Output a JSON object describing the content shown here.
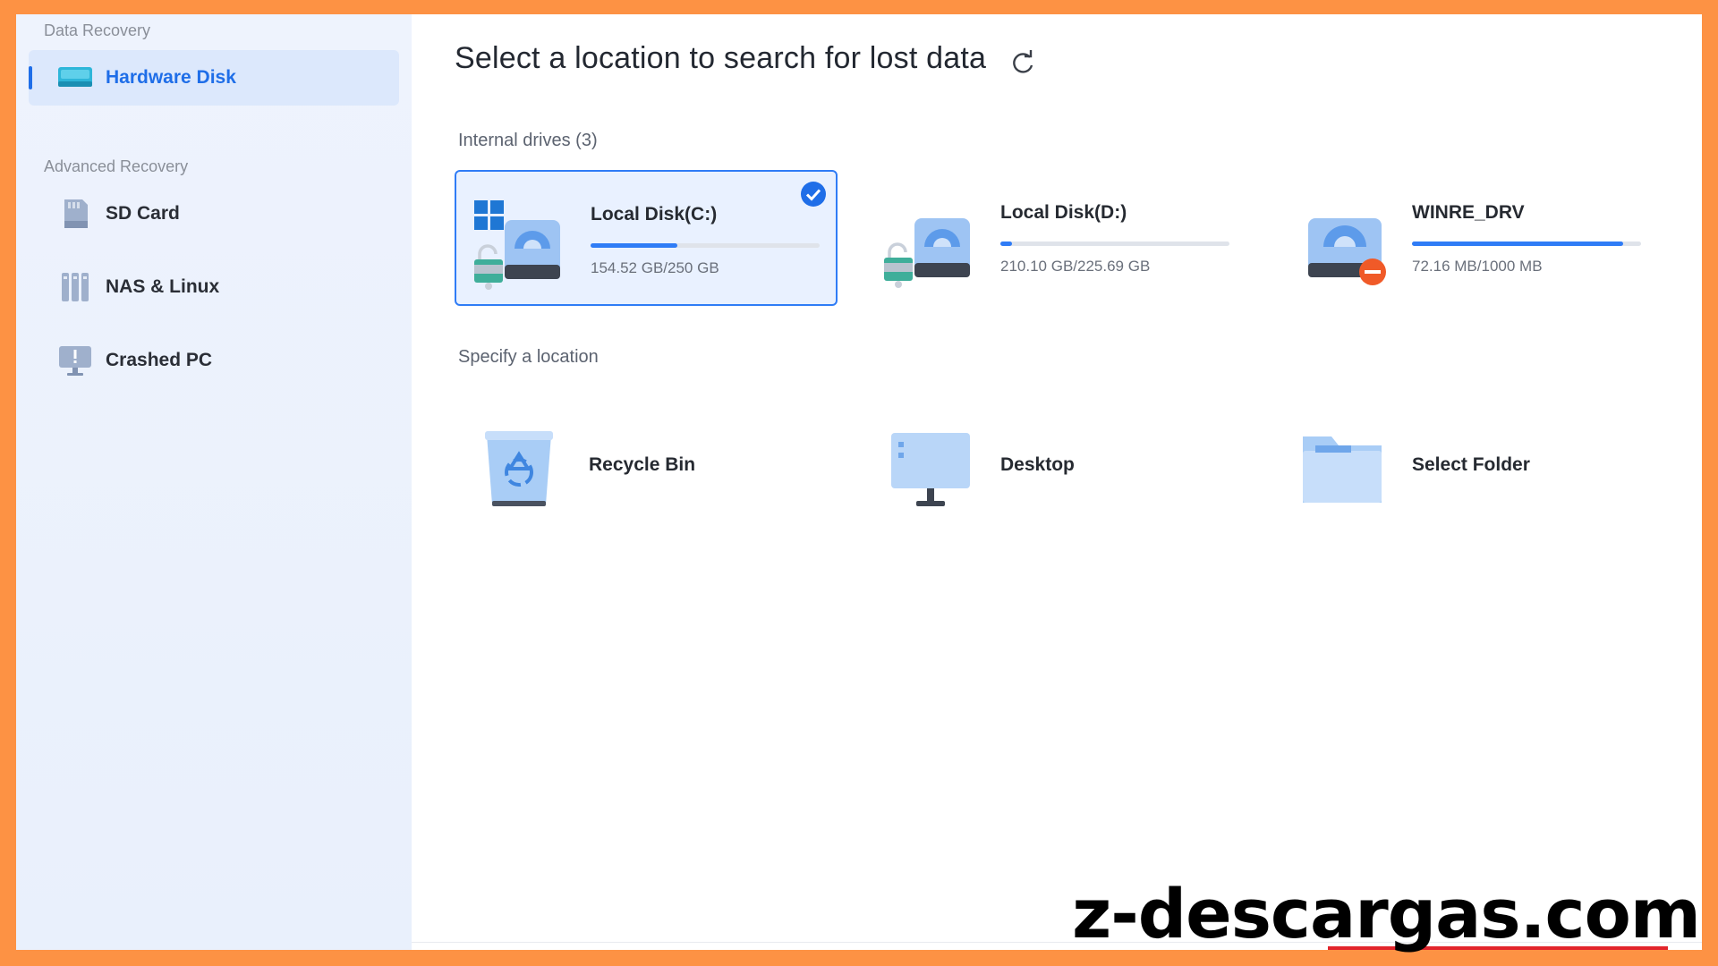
{
  "sidebar": {
    "section_data_recovery": "Data Recovery",
    "section_advanced": "Advanced Recovery",
    "items": [
      {
        "label": "Hardware Disk",
        "icon": "hard-disk-icon",
        "active": true
      },
      {
        "label": "SD Card",
        "icon": "sd-card-icon",
        "active": false
      },
      {
        "label": "NAS & Linux",
        "icon": "nas-icon",
        "active": false
      },
      {
        "label": "Crashed PC",
        "icon": "crashed-pc-icon",
        "active": false
      }
    ]
  },
  "main": {
    "title": "Select a location to search for lost data",
    "internal_label": "Internal drives (3)",
    "drives": [
      {
        "name": "Local Disk(C:)",
        "size": "154.52 GB/250 GB",
        "used_fraction": 0.38,
        "selected": true,
        "icon": "system-drive-locked-icon"
      },
      {
        "name": "Local Disk(D:)",
        "size": "210.10 GB/225.69 GB",
        "used_fraction": 0.05,
        "selected": false,
        "icon": "drive-locked-icon"
      },
      {
        "name": "WINRE_DRV",
        "size": "72.16 MB/1000 MB",
        "used_fraction": 0.92,
        "selected": false,
        "icon": "drive-error-icon"
      }
    ],
    "specify_label": "Specify a location",
    "locations": [
      {
        "name": "Recycle Bin",
        "icon": "recycle-bin-icon"
      },
      {
        "name": "Desktop",
        "icon": "desktop-icon"
      },
      {
        "name": "Select Folder",
        "icon": "folder-icon"
      }
    ]
  },
  "watermark": "z-descargas.com",
  "colors": {
    "accent": "#2f7cf6",
    "frame": "#fd9244",
    "sidebar_bg": "#eef3fd",
    "error": "#f05a28"
  }
}
